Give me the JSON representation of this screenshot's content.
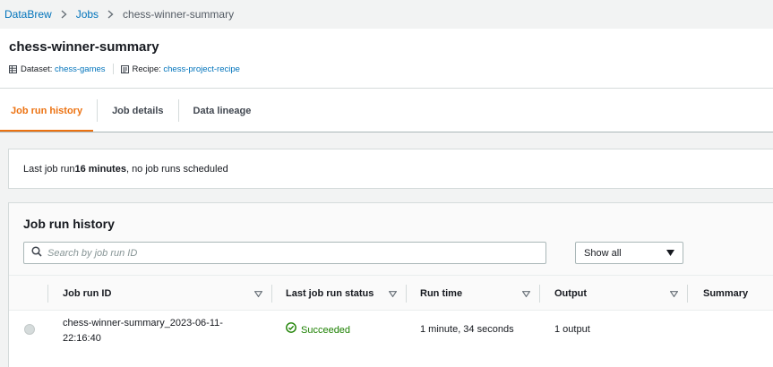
{
  "breadcrumb": {
    "root": "DataBrew",
    "parent": "Jobs",
    "current": "chess-winner-summary"
  },
  "header": {
    "title": "chess-winner-summary",
    "dataset_label": "Dataset:",
    "dataset_value": "chess-games",
    "recipe_label": "Recipe:",
    "recipe_value": "chess-project-recipe"
  },
  "tabs": [
    {
      "label": "Job run history",
      "active": true
    },
    {
      "label": "Job details",
      "active": false
    },
    {
      "label": "Data lineage",
      "active": false
    }
  ],
  "status": {
    "prefix": "Last job run ",
    "duration": "16 minutes",
    "suffix": ", no job runs scheduled"
  },
  "history": {
    "title": "Job run history",
    "search_placeholder": "Search by job run ID",
    "filter_value": "Show all",
    "columns": [
      "Job run ID",
      "Last job run status",
      "Run time",
      "Output",
      "Summary"
    ],
    "rows": [
      {
        "job_run_id": "chess-winner-summary_2023-06-11-22:16:40",
        "status": "Succeeded",
        "run_time": "1 minute, 34 seconds",
        "output": "1 output",
        "summary": ""
      }
    ]
  },
  "colors": {
    "accent": "#ec7211",
    "link": "#0073bb",
    "success": "#1d8102"
  }
}
